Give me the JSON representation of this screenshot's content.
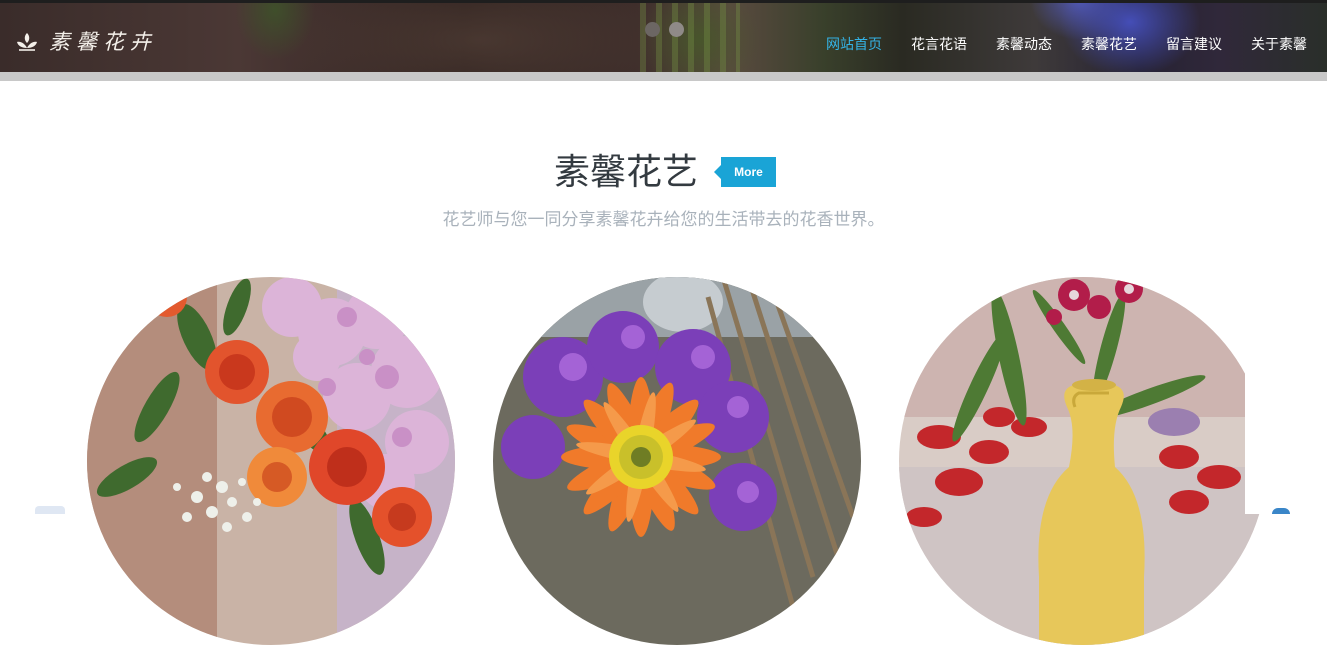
{
  "header": {
    "logo_text": "素馨花卉",
    "nav": [
      {
        "label": "网站首页",
        "active": true
      },
      {
        "label": "花言花语",
        "active": false
      },
      {
        "label": "素馨动态",
        "active": false
      },
      {
        "label": "素馨花艺",
        "active": false
      },
      {
        "label": "留言建议",
        "active": false
      },
      {
        "label": "关于素馨",
        "active": false
      }
    ],
    "slider_dots": 2,
    "active_color": "#34b3e6"
  },
  "section": {
    "title": "素馨花艺",
    "more_label": "More",
    "subtitle": "花艺师与您一同分享素馨花卉给您的生活带去的花香世界。",
    "accent_color": "#1aa4d6"
  },
  "gallery": {
    "items": [
      {
        "name": "rose-bouquet-photo"
      },
      {
        "name": "gerbera-photo"
      },
      {
        "name": "vase-flower-photo"
      }
    ]
  }
}
